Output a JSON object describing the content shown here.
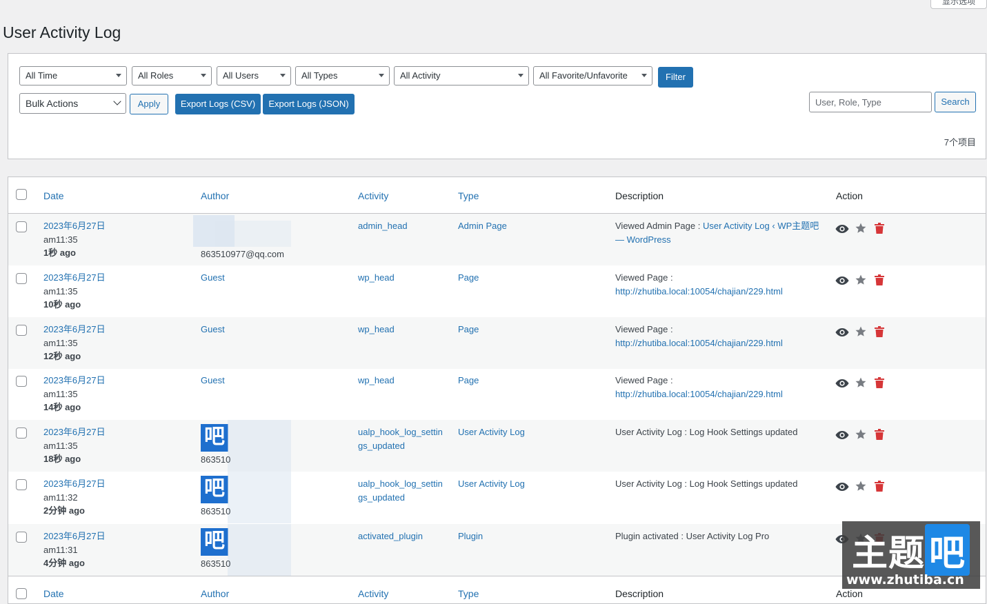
{
  "top_tab": {
    "label": "显示选项"
  },
  "page": {
    "title": "User Activity Log"
  },
  "filters": {
    "time": "All Time",
    "roles": "All Roles",
    "users": "All Users",
    "types": "All Types",
    "activity": "All Activity",
    "favorite": "All Favorite/Unfavorite",
    "filter_button": "Filter",
    "bulk_actions": "Bulk Actions",
    "apply_button": "Apply",
    "export_csv": "Export Logs (CSV)",
    "export_json": "Export Logs (JSON)",
    "search_placeholder": "User, Role, Type",
    "search_button": "Search",
    "items_count": "7个项目"
  },
  "table": {
    "columns": {
      "date": "Date",
      "author": "Author",
      "activity": "Activity",
      "type": "Type",
      "description": "Description",
      "action": "Action"
    },
    "rows": [
      {
        "date": "2023年6月27日",
        "time": "am11:35",
        "ago_num": "1秒",
        "ago": " ago",
        "author": "",
        "author_email": "863510977@qq.com",
        "activity": "admin_head",
        "type": "Admin Page",
        "desc_prefix": "Viewed Admin Page : ",
        "desc_link": "User Activity Log ‹ WP主题吧 — WordPress"
      },
      {
        "date": "2023年6月27日",
        "time": "am11:35",
        "ago_num": "10秒",
        "ago": " ago",
        "author": "Guest",
        "author_email": "",
        "activity": "wp_head",
        "type": "Page",
        "desc_prefix": "Viewed Page : ",
        "desc_link": "http://zhutiba.local:10054/chajian/229.html"
      },
      {
        "date": "2023年6月27日",
        "time": "am11:35",
        "ago_num": "12秒",
        "ago": " ago",
        "author": "Guest",
        "author_email": "",
        "activity": "wp_head",
        "type": "Page",
        "desc_prefix": "Viewed Page : ",
        "desc_link": "http://zhutiba.local:10054/chajian/229.html"
      },
      {
        "date": "2023年6月27日",
        "time": "am11:35",
        "ago_num": "14秒",
        "ago": " ago",
        "author": "Guest",
        "author_email": "",
        "activity": "wp_head",
        "type": "Page",
        "desc_prefix": "Viewed Page : ",
        "desc_link": "http://zhutiba.local:10054/chajian/229.html"
      },
      {
        "date": "2023年6月27日",
        "time": "am11:35",
        "ago_num": "18秒",
        "ago": " ago",
        "author": "",
        "author_email": "863510",
        "activity": "ualp_hook_log_settings_updated",
        "type": "User Activity Log",
        "desc_prefix": "User Activity Log : Log Hook Settings updated",
        "desc_link": ""
      },
      {
        "date": "2023年6月27日",
        "time": "am11:32",
        "ago_num": "2分钟",
        "ago": " ago",
        "author": "",
        "author_email": "863510",
        "activity": "ualp_hook_log_settings_updated",
        "type": "User Activity Log",
        "desc_prefix": "User Activity Log : Log Hook Settings updated",
        "desc_link": ""
      },
      {
        "date": "2023年6月27日",
        "time": "am11:31",
        "ago_num": "4分钟",
        "ago": " ago",
        "author": "",
        "author_email": "863510",
        "activity": "activated_plugin",
        "type": "Plugin",
        "desc_prefix": "Plugin activated : User Activity Log Pro",
        "desc_link": ""
      }
    ]
  },
  "avatar_glyph": "吧",
  "icons": {
    "view": "eye-icon",
    "favorite": "star-icon",
    "delete": "trash-icon"
  },
  "colors": {
    "accent": "#2271b1",
    "delete": "#d63638",
    "star": "#787c82"
  },
  "watermark": {
    "text": "主题",
    "box": "吧",
    "url": "www.zhutiba.cn"
  }
}
